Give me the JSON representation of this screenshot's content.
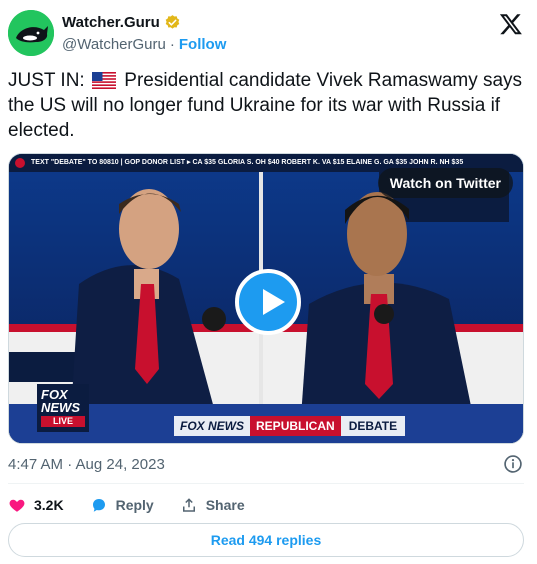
{
  "account": {
    "name": "Watcher.Guru",
    "handle": "@WatcherGuru",
    "follow_label": "Follow",
    "avatar_icon": "killer-whale-icon",
    "verified_icon": "gold-verified-badge-icon"
  },
  "tweet": {
    "text_prefix": "JUST IN:",
    "text_body": "Presidential candidate Vivek Ramaswamy says the US will no longer fund Ukraine for its war with Russia if elected.",
    "flag_icon": "us-flag-icon"
  },
  "media": {
    "ticker_text": "TEXT \"DEBATE\" TO 80810  |  GOP DONOR LIST  ▸ CA  $35 GLORIA S.  OH  $40 ROBERT K.  VA  $15 ELAINE G.  GA  $35 JOHN R.  NH  $35",
    "watch_label": "Watch on Twitter",
    "network_logo_lines": [
      "FOX",
      "NEWS"
    ],
    "live_label": "LIVE",
    "banner_network": "FOX NEWS",
    "banner_highlight": "REPUBLICAN",
    "banner_tail": "DEBATE",
    "play_icon": "play-icon"
  },
  "meta": {
    "timestamp": "4:47 AM · Aug 24, 2023"
  },
  "actions": {
    "like_count": "3.2K",
    "reply_label": "Reply",
    "share_label": "Share"
  },
  "read_replies_label": "Read 494 replies",
  "colors": {
    "accent": "#1d9bf0",
    "like": "#f91880",
    "text": "#0f1419",
    "muted": "#536471"
  }
}
